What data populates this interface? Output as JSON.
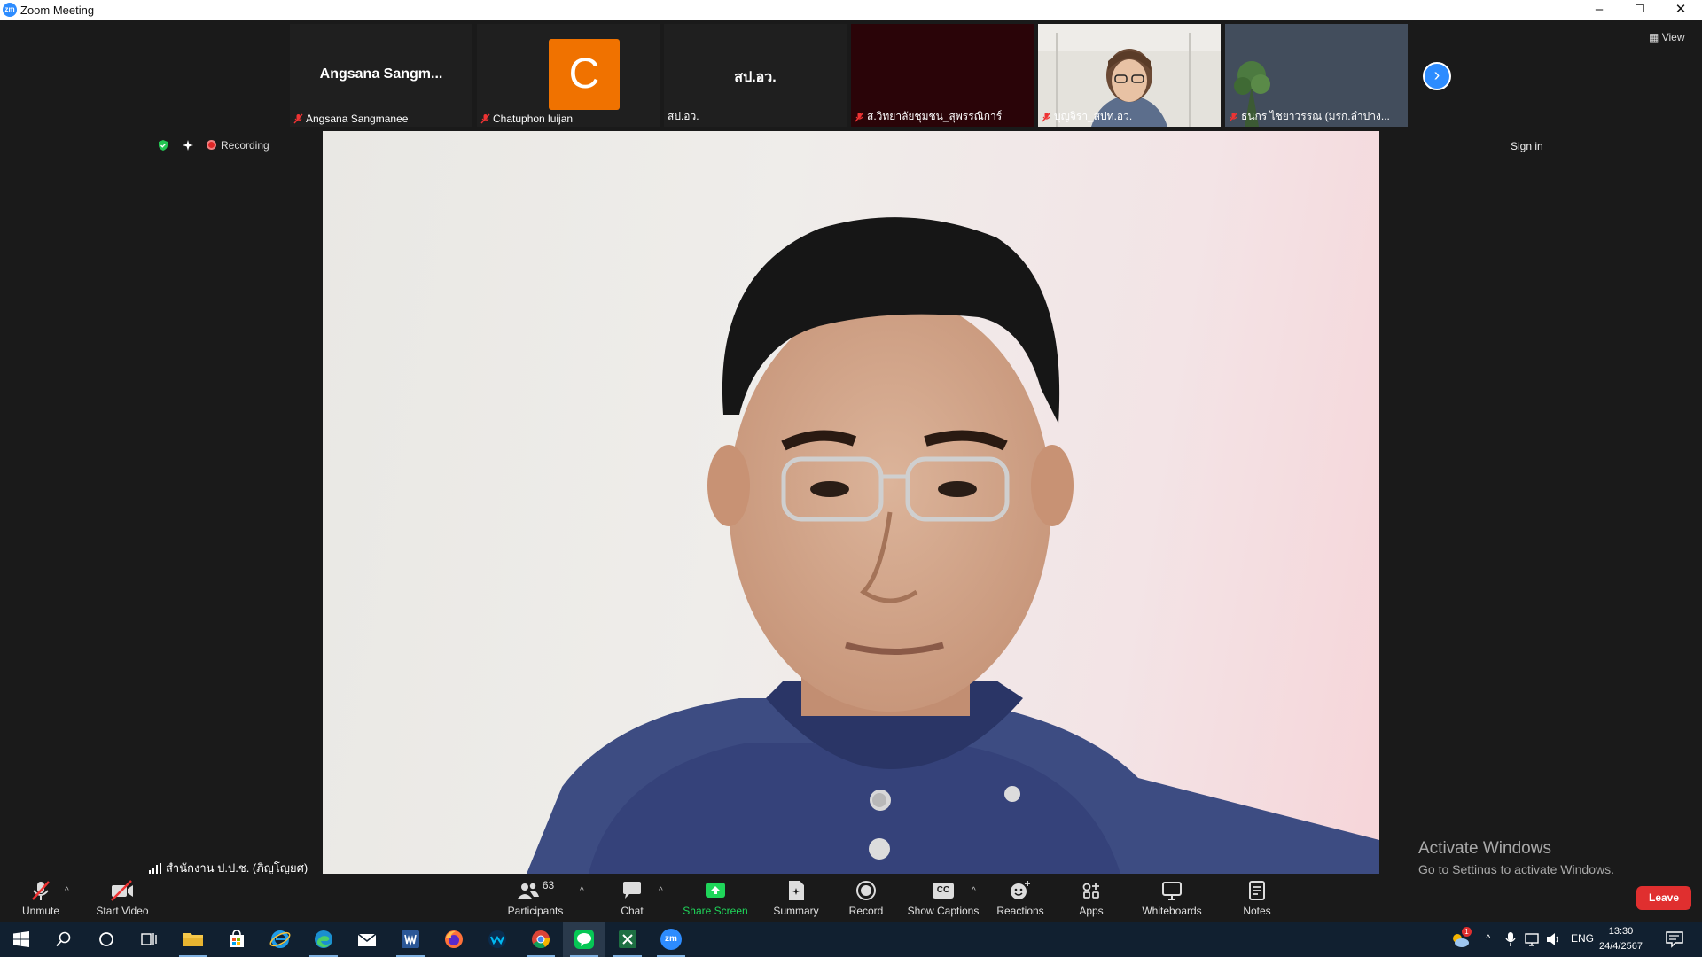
{
  "window": {
    "title": "Zoom Meeting",
    "logo_text": "zm",
    "minimize": "–",
    "restore": "❐",
    "close": "✕"
  },
  "thumbnails": [
    {
      "center": "Angsana  Sangm...",
      "label": "Angsana Sangmanee",
      "muted": true
    },
    {
      "avatar": "C",
      "label": "Chatuphon luijan",
      "muted": true
    },
    {
      "center": "สป.อว.",
      "label": "สป.อว.",
      "muted": false
    },
    {
      "label": "ส.วิทยาลัยชุมชน_สุพรรณิการ์",
      "muted": true
    },
    {
      "label": "บุญจิรา_สปท.อว.",
      "muted": true
    },
    {
      "label": "ธนกร ไชยาวรรณ (มรก.ลำปาง...",
      "muted": true
    }
  ],
  "view_label": "View",
  "status": {
    "recording": "Recording"
  },
  "sign_in": "Sign in",
  "active_speaker": "สำนักงาน ป.ป.ช. (ภิญโญยศ)",
  "watermark": {
    "line1": "Activate Windows",
    "line2": "Go to Settings to activate Windows."
  },
  "toolbar": {
    "unmute": "Unmute",
    "start_video": "Start Video",
    "participants": "Participants",
    "participants_count": "63",
    "chat": "Chat",
    "share_screen": "Share Screen",
    "summary": "Summary",
    "record": "Record",
    "show_captions": "Show Captions",
    "reactions": "Reactions",
    "apps": "Apps",
    "whiteboards": "Whiteboards",
    "notes": "Notes",
    "leave": "Leave",
    "captions_icon_text": "CC"
  },
  "taskbar": {
    "language": "ENG",
    "time": "13:30",
    "date": "24/4/2567",
    "zoom_text": "zm",
    "notification_count": "1"
  },
  "colors": {
    "accent": "#2d8cff",
    "leave": "#e02f2f",
    "share": "#1fd65a",
    "avatar": "#f07200"
  }
}
